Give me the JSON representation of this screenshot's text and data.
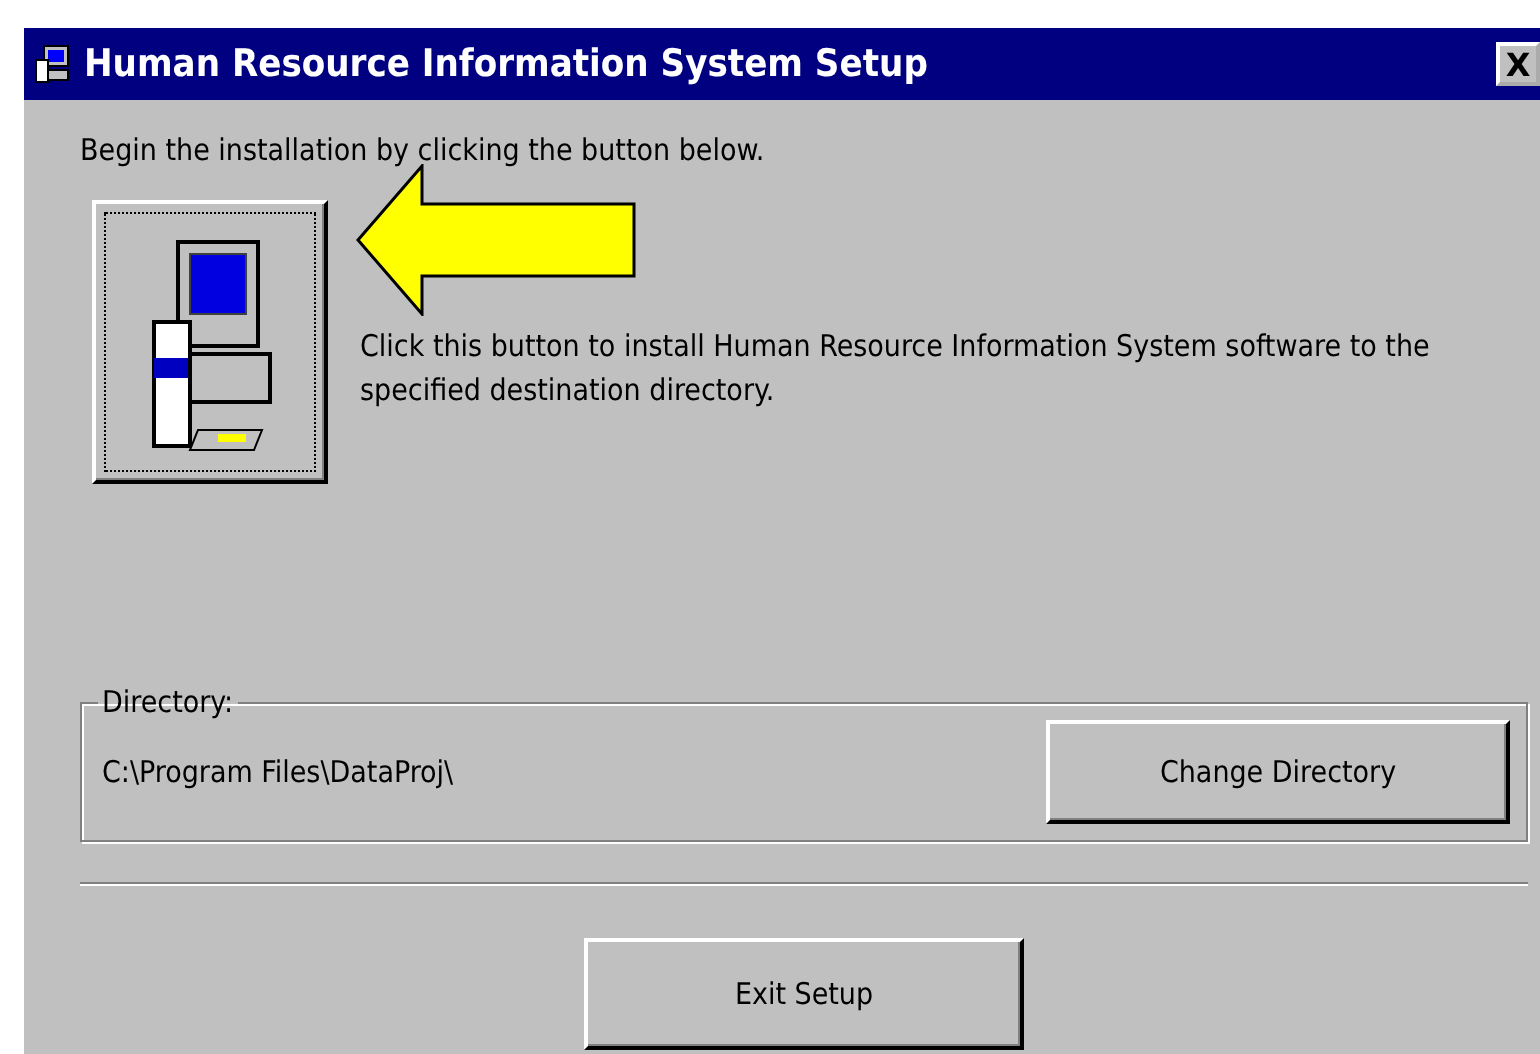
{
  "window": {
    "title": "Human Resource Information System Setup",
    "close_label": "X"
  },
  "intro": "Begin the installation by clicking the button below.",
  "install": {
    "description": "Click this button to install Human Resource Information System software to the specified destination directory.",
    "focused": true
  },
  "directory": {
    "label": "Directory:",
    "path": "C:\\Program Files\\DataProj\\",
    "button": "Change Directory"
  },
  "exit_button": "Exit Setup"
}
